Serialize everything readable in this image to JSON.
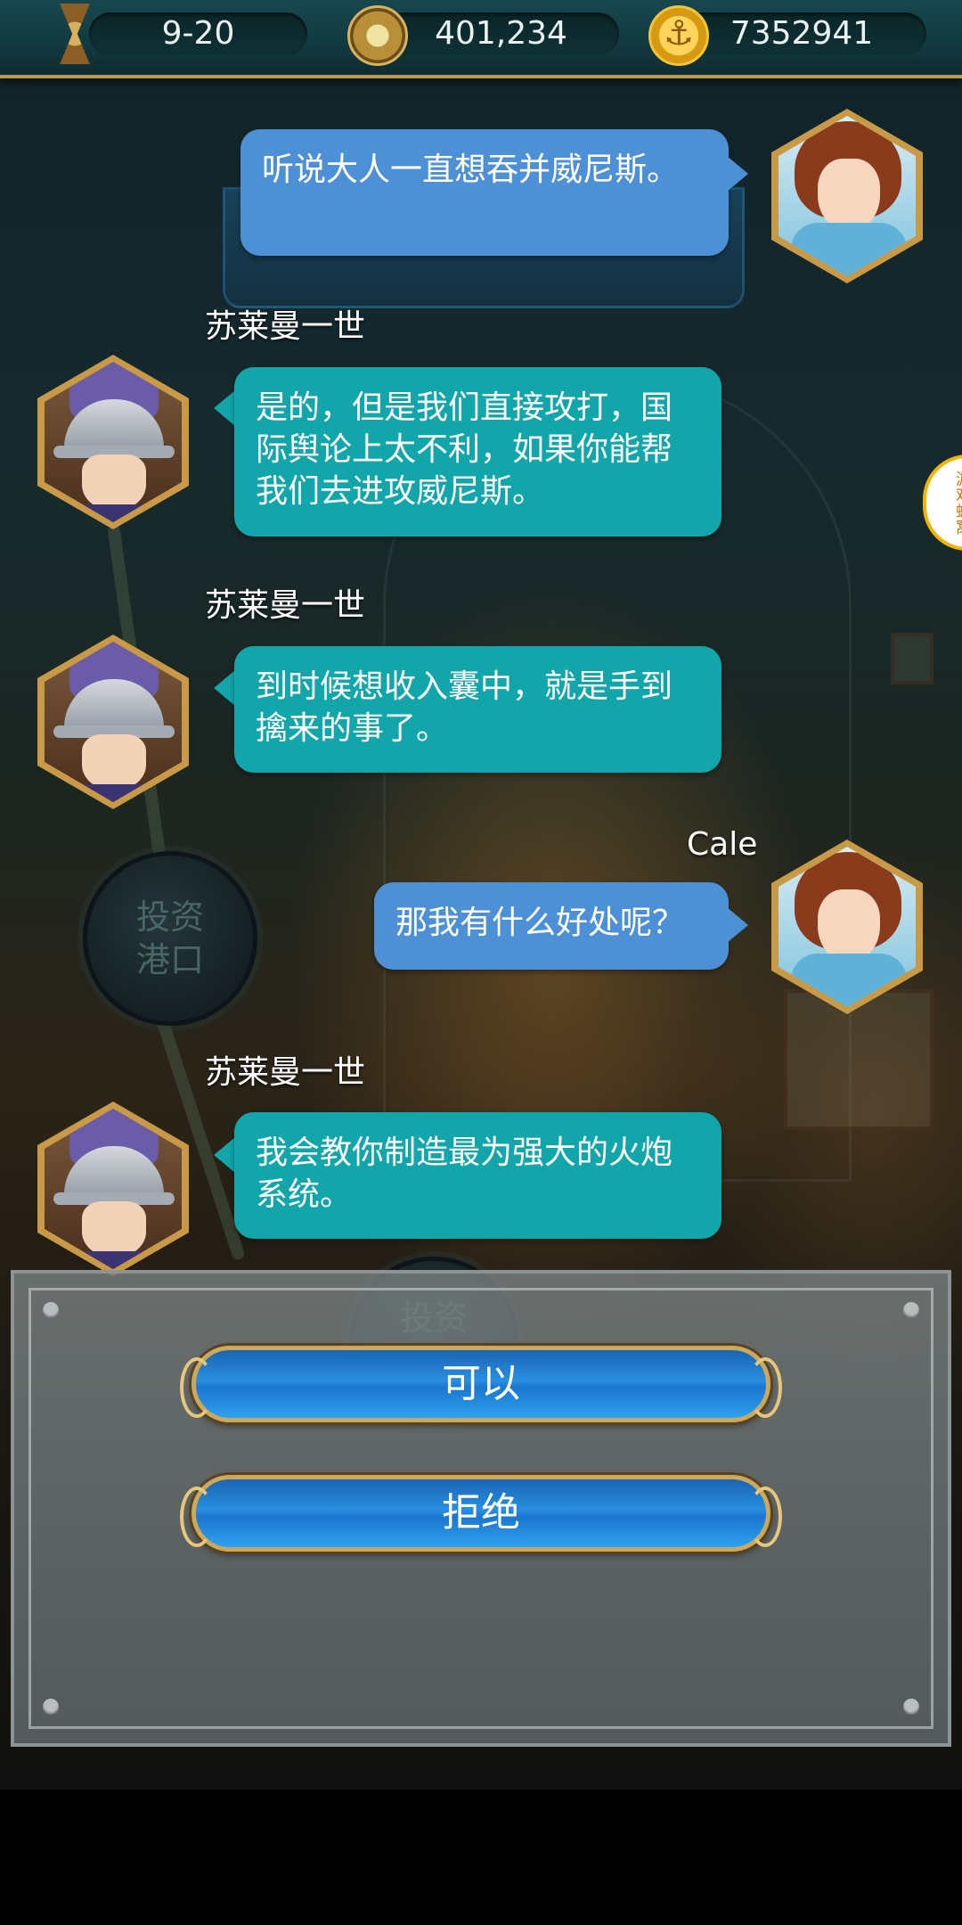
{
  "resources": {
    "date": "9-20",
    "compass_value": "401,234",
    "gold": "7352941",
    "icons": [
      "hourglass-icon",
      "compass-icon",
      "anchor-coin-icon"
    ]
  },
  "background": {
    "node1": "投资\n港口",
    "node2": "投资"
  },
  "side_tab": {
    "label": "游戏蜂窝"
  },
  "messages": [
    {
      "speaker": "",
      "text": "听说大人一直想吞并威尼斯。",
      "side": "right"
    },
    {
      "speaker": "苏莱曼一世",
      "text": "是的，但是我们直接攻打，国际舆论上太不利，如果你能帮我们去进攻威尼斯。",
      "side": "left"
    },
    {
      "speaker": "苏莱曼一世",
      "text": "到时候想收入囊中，就是手到擒来的事了。",
      "side": "left"
    },
    {
      "speaker": "Cale",
      "text": "那我有什么好处呢？",
      "side": "right"
    },
    {
      "speaker": "苏莱曼一世",
      "text": "我会教你制造最为强大的火炮系统。",
      "side": "left"
    }
  ],
  "choices": {
    "accept": "可以",
    "reject": "拒绝"
  },
  "colors": {
    "player_bubble": "#4e90d6",
    "npc_bubble": "#12a5a9",
    "frame_gold": "#c89a48"
  }
}
